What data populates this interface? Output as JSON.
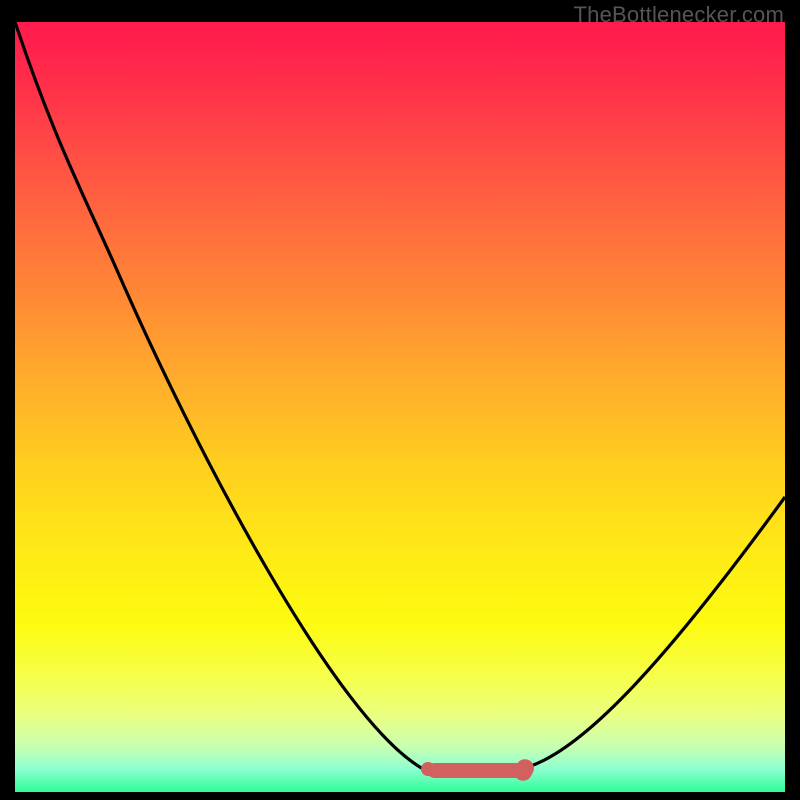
{
  "watermark": "TheBottlenecker.com",
  "colors": {
    "background": "#000000",
    "curve": "#000000",
    "marker": "#d1605e",
    "gradient_top": "#ff1a4d",
    "gradient_mid": "#ffe817",
    "gradient_bottom": "#2efc96"
  },
  "chart_data": {
    "type": "line",
    "title": "",
    "xlabel": "",
    "ylabel": "",
    "xlim": [
      0,
      100
    ],
    "ylim": [
      0,
      100
    ],
    "series": [
      {
        "name": "bottleneck-curve",
        "x": [
          0,
          5,
          10,
          14,
          20,
          30,
          40,
          50,
          53,
          58,
          62,
          66,
          72,
          80,
          90,
          100
        ],
        "y": [
          100,
          90,
          80,
          67,
          55,
          33,
          18,
          5,
          3,
          3,
          3,
          3,
          5,
          12,
          25,
          38
        ]
      }
    ],
    "annotations": [
      {
        "name": "optimum-range",
        "x_start": 53,
        "x_end": 66,
        "y": 3,
        "color": "#d1605e"
      }
    ],
    "background_gradient": {
      "direction": "vertical",
      "stops": [
        {
          "pos": 0.0,
          "color": "#ff1a4d"
        },
        {
          "pos": 0.5,
          "color": "#ffd01e"
        },
        {
          "pos": 0.8,
          "color": "#fdfb0f"
        },
        {
          "pos": 1.0,
          "color": "#2efc96"
        }
      ]
    }
  }
}
